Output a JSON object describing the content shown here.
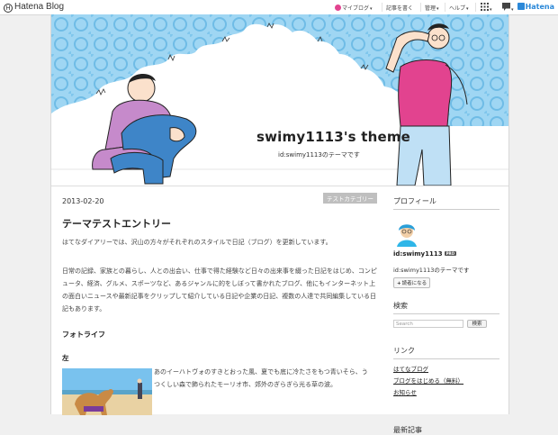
{
  "topbar": {
    "logo_text": "Hatena Blog",
    "items": [
      {
        "label": "マイブログ"
      },
      {
        "label": "記事を書く"
      },
      {
        "label": "管理"
      },
      {
        "label": "ヘルプ"
      }
    ],
    "hatena_label": "Hatena"
  },
  "header": {
    "title": "swimy1113's theme",
    "description": "id:swimy1113のテーマです"
  },
  "entry": {
    "date": "2013-02-20",
    "category": "テストカテゴリー",
    "title": "テーマテストエントリー",
    "paragraph1": "はてなダイアリーでは、沢山の方々がそれぞれのスタイルで日記（ブログ）を更新しています。",
    "paragraph2": "日常の記録、家族との暮らし、人との出会い、仕事で得た経験など日々の出来事を綴った日記をはじめ、コンピュータ、経済、グルメ、スポーツなど、あるジャンルに的をしぼって書かれたブログ、他にもインターネット上の面白いニュースや最新記事をクリップして紹介している日記や企業の日記、複数の人達で共同編集している日記もあります。",
    "section_heading": "フォトライフ",
    "sub_heading": "左",
    "photo_caption": "あのイーハトヴォのすきとおった風、夏でも底に冷たさをもつ青いそら、うつくしい森で飾られたモーリオ市、郊外のぎらぎら光る草の波。"
  },
  "sidebar": {
    "profile_heading": "プロフィール",
    "profile_name": "id:swimy1113",
    "pro_badge": "PRO",
    "profile_desc": "id:swimy1113のテーマです",
    "reader_button": "読者になる",
    "search_heading": "検索",
    "search_placeholder": "Search",
    "search_button": "検索",
    "links_heading": "リンク",
    "links": [
      {
        "label": "はてなブログ"
      },
      {
        "label": "ブログをはじめる（無料）"
      },
      {
        "label": "お知らせ"
      }
    ],
    "recent_heading": "最新記事"
  },
  "colors": {
    "accent_blue": "#2b88d8",
    "header_sky": "#8ccdf0",
    "shirt_pink": "#e2438f",
    "shirt_violet": "#c07bc8",
    "jeans_blue": "#3e85c8"
  }
}
